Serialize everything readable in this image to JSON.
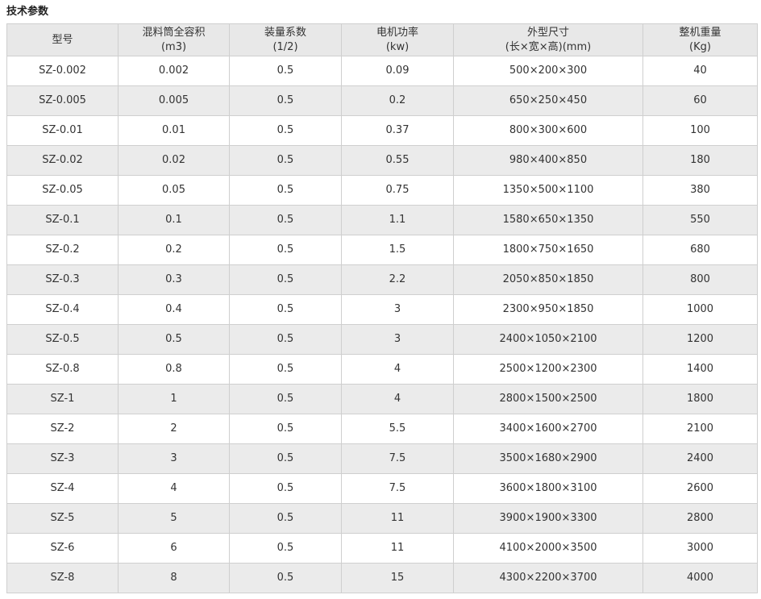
{
  "page": {
    "title": "技术参数"
  },
  "table": {
    "headers": [
      {
        "line1": "型号",
        "line2": ""
      },
      {
        "line1": "混料筒全容积",
        "line2": "(m3)"
      },
      {
        "line1": "装量系数",
        "line2": "(1/2)"
      },
      {
        "line1": "电机功率",
        "line2": "(kw)"
      },
      {
        "line1": "外型尺寸",
        "line2": "(长×宽×高)(mm)"
      },
      {
        "line1": "整机重量",
        "line2": "(Kg)"
      }
    ],
    "rows": [
      [
        "SZ-0.002",
        "0.002",
        "0.5",
        "0.09",
        "500×200×300",
        "40"
      ],
      [
        "SZ-0.005",
        "0.005",
        "0.5",
        "0.2",
        "650×250×450",
        "60"
      ],
      [
        "SZ-0.01",
        "0.01",
        "0.5",
        "0.37",
        "800×300×600",
        "100"
      ],
      [
        "SZ-0.02",
        "0.02",
        "0.5",
        "0.55",
        "980×400×850",
        "180"
      ],
      [
        "SZ-0.05",
        "0.05",
        "0.5",
        "0.75",
        "1350×500×1100",
        "380"
      ],
      [
        "SZ-0.1",
        "0.1",
        "0.5",
        "1.1",
        "1580×650×1350",
        "550"
      ],
      [
        "SZ-0.2",
        "0.2",
        "0.5",
        "1.5",
        "1800×750×1650",
        "680"
      ],
      [
        "SZ-0.3",
        "0.3",
        "0.5",
        "2.2",
        "2050×850×1850",
        "800"
      ],
      [
        "SZ-0.4",
        "0.4",
        "0.5",
        "3",
        "2300×950×1850",
        "1000"
      ],
      [
        "SZ-0.5",
        "0.5",
        "0.5",
        "3",
        "2400×1050×2100",
        "1200"
      ],
      [
        "SZ-0.8",
        "0.8",
        "0.5",
        "4",
        "2500×1200×2300",
        "1400"
      ],
      [
        "SZ-1",
        "1",
        "0.5",
        "4",
        "2800×1500×2500",
        "1800"
      ],
      [
        "SZ-2",
        "2",
        "0.5",
        "5.5",
        "3400×1600×2700",
        "2100"
      ],
      [
        "SZ-3",
        "3",
        "0.5",
        "7.5",
        "3500×1680×2900",
        "2400"
      ],
      [
        "SZ-4",
        "4",
        "0.5",
        "7.5",
        "3600×1800×3100",
        "2600"
      ],
      [
        "SZ-5",
        "5",
        "0.5",
        "11",
        "3900×1900×3300",
        "2800"
      ],
      [
        "SZ-6",
        "6",
        "0.5",
        "11",
        "4100×2000×3500",
        "3000"
      ],
      [
        "SZ-8",
        "8",
        "0.5",
        "15",
        "4300×2200×3700",
        "4000"
      ]
    ]
  }
}
